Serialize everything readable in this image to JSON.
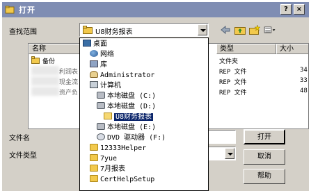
{
  "window": {
    "title": "打开",
    "help_label": "?",
    "close_label": "×"
  },
  "lookin": {
    "label": "查找范围",
    "value": "U8财务报表"
  },
  "toolbar": {
    "back_icon": "back-arrow-icon",
    "up_icon": "up-folder-icon",
    "new_folder_icon": "new-folder-icon",
    "view_icon": "view-menu-icon"
  },
  "filelist": {
    "columns": [
      "名称",
      "类型",
      "大小"
    ],
    "rows": [
      {
        "name": "备份",
        "type": "文件夹",
        "size": ""
      },
      {
        "name": "利润表",
        "type": "REP 文件",
        "size": "34"
      },
      {
        "name": "现金流",
        "type": "REP 文件",
        "size": "33"
      },
      {
        "name": "资产负",
        "type": "REP 文件",
        "size": "48"
      }
    ]
  },
  "filename": {
    "label": "文件名",
    "value": ""
  },
  "filetype": {
    "label": "文件类型",
    "value": ""
  },
  "buttons": {
    "open": "打开",
    "cancel": "取消",
    "help": "帮助"
  },
  "dropdown": {
    "items": [
      {
        "label": "桌面",
        "icon": "desktop-icon"
      },
      {
        "label": "网络",
        "icon": "network-icon"
      },
      {
        "label": "库",
        "icon": "library-icon"
      },
      {
        "label": "Administrator",
        "icon": "user-folder-icon"
      },
      {
        "label": "计算机",
        "icon": "computer-icon"
      },
      {
        "label": "本地磁盘 (C:)",
        "icon": "drive-icon"
      },
      {
        "label": "本地磁盘 (D:)",
        "icon": "drive-icon"
      },
      {
        "label": "U8财务报表",
        "icon": "folder-open-icon",
        "selected": true
      },
      {
        "label": "本地磁盘 (E:)",
        "icon": "drive-icon"
      },
      {
        "label": "DVD 驱动器 (F:)",
        "icon": "dvd-drive-icon"
      },
      {
        "label": "12333Helper",
        "icon": "folder-icon"
      },
      {
        "label": "7yue",
        "icon": "folder-icon"
      },
      {
        "label": "7月报表",
        "icon": "folder-icon"
      },
      {
        "label": "CertHelpSetup",
        "icon": "folder-icon"
      }
    ]
  }
}
